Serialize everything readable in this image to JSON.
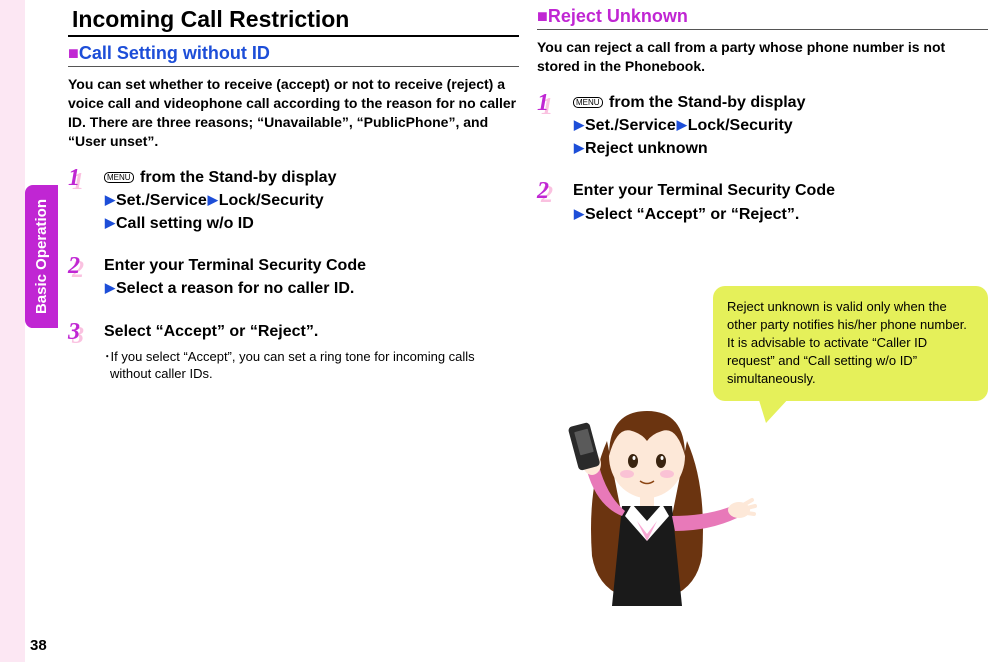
{
  "page_number": "38",
  "sidebar_tab": "Basic Operation",
  "left": {
    "heading": "Incoming Call Restriction",
    "subheading": "Call Setting without ID",
    "intro": "You can set whether to receive (accept) or not to receive (reject) a voice call and videophone call according to the reason for no caller ID. There are three reasons; “Unavailable”, “PublicPhone”, and “User unset”.",
    "steps": {
      "1": {
        "num": "1",
        "menu": "MENU",
        "l1_after": " from the Stand-by display",
        "l2a": "Set./Service",
        "l2b": "Lock/Security",
        "l3": "Call setting w/o ID"
      },
      "2": {
        "num": "2",
        "l1": "Enter your Terminal Security Code",
        "l2": "Select a reason for no caller ID."
      },
      "3": {
        "num": "3",
        "l1": "Select “Accept” or “Reject”.",
        "sub": "If you select “Accept”, you can set a ring tone for incoming calls without caller IDs."
      }
    }
  },
  "right": {
    "subheading": "Reject Unknown",
    "intro": "You can reject a call from a party whose phone number is not stored in the Phonebook.",
    "steps": {
      "1": {
        "num": "1",
        "menu": "MENU",
        "l1_after": " from the Stand-by display",
        "l2a": "Set./Service",
        "l2b": "Lock/Security",
        "l3": "Reject unknown"
      },
      "2": {
        "num": "2",
        "l1": "Enter your Terminal Security Code",
        "l2": "Select “Accept” or “Reject”."
      }
    },
    "tip": "Reject unknown is valid only when the other party notifies his/her phone number. It is advisable to activate “Caller ID request” and “Call setting w/o ID” simultaneously."
  }
}
